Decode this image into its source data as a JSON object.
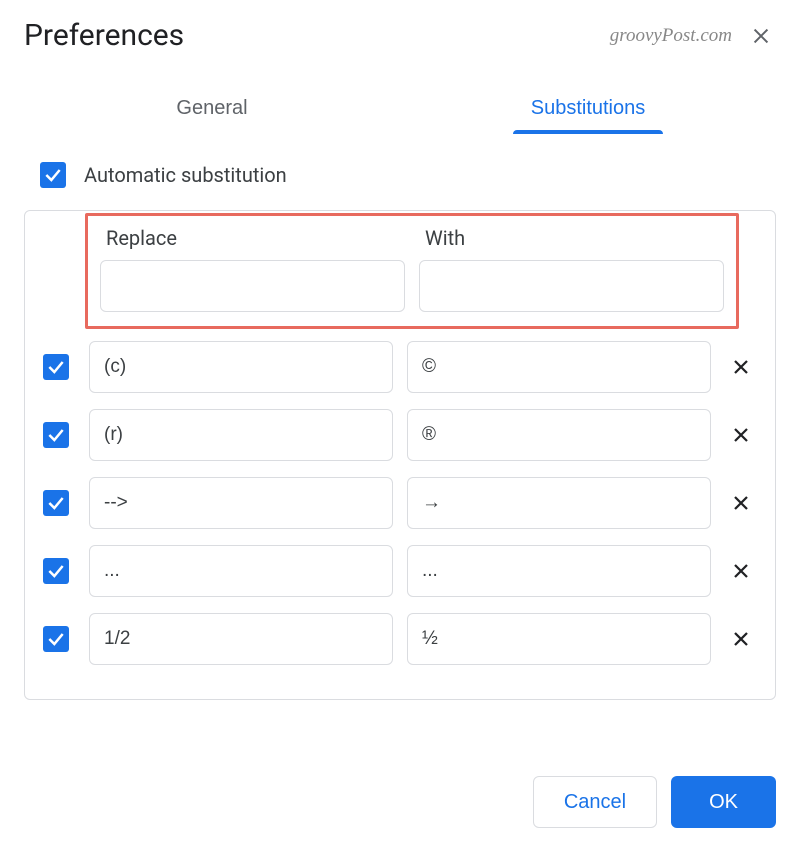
{
  "dialog": {
    "title": "Preferences",
    "watermark": "groovyPost.com"
  },
  "tabs": {
    "general": "General",
    "substitutions": "Substitutions"
  },
  "autoSub": {
    "label": "Automatic substitution",
    "checked": true
  },
  "columns": {
    "replace": "Replace",
    "with": "With"
  },
  "newRow": {
    "replace": "",
    "with": ""
  },
  "substitutionRows": [
    {
      "checked": true,
      "replace": "(c)",
      "with": "©"
    },
    {
      "checked": true,
      "replace": "(r)",
      "with": "®"
    },
    {
      "checked": true,
      "replace": "-->",
      "with": "→"
    },
    {
      "checked": true,
      "replace": "...",
      "with": "..."
    },
    {
      "checked": true,
      "replace": "1/2",
      "with": "½"
    }
  ],
  "buttons": {
    "cancel": "Cancel",
    "ok": "OK"
  }
}
